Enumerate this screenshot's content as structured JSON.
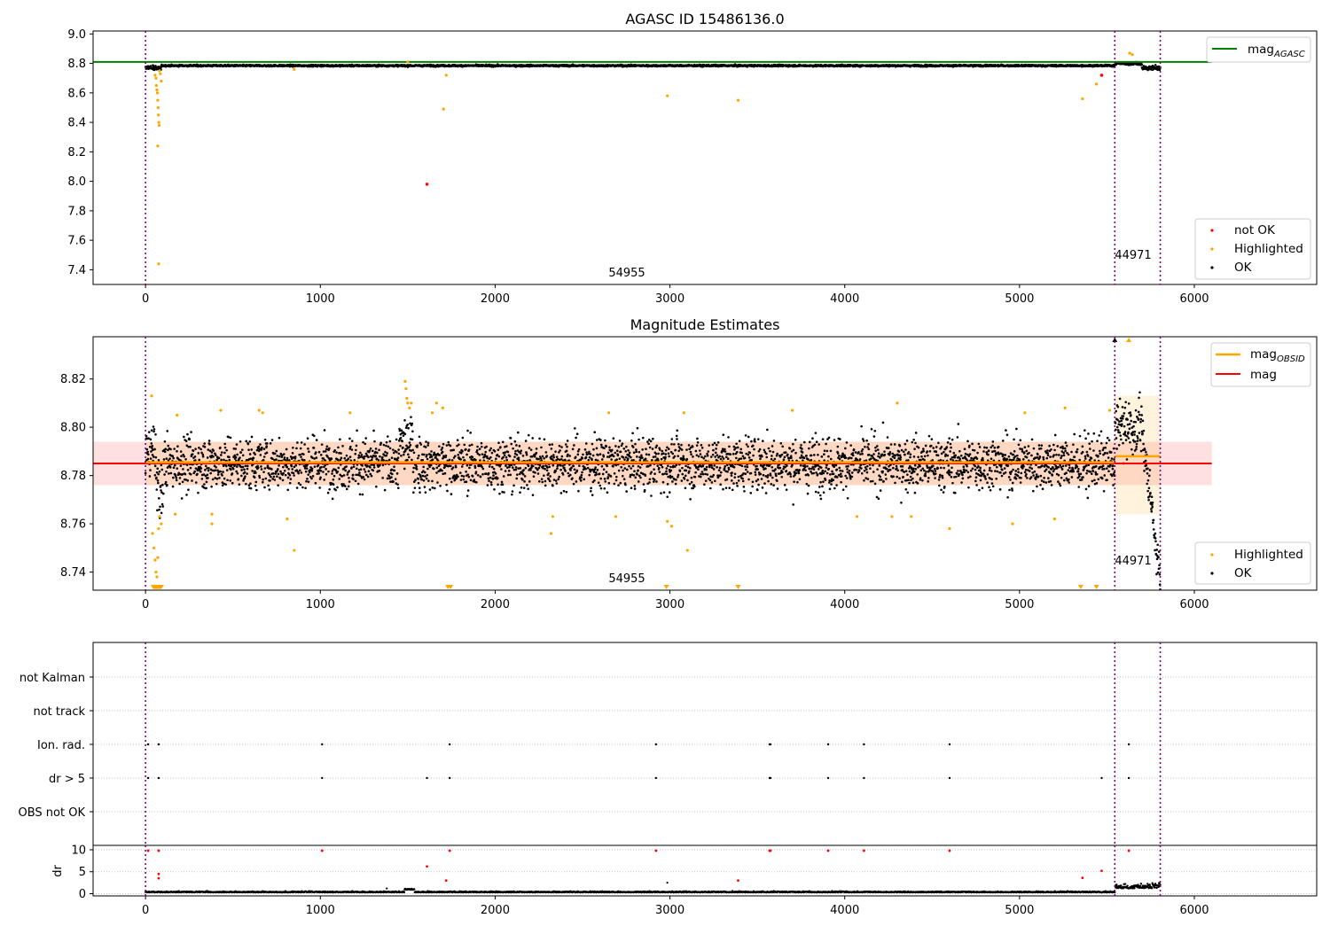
{
  "chart_data": [
    {
      "type": "scatter",
      "title": "AGASC ID 15486136.0",
      "xlim": [
        -300,
        6700
      ],
      "ylim": [
        7.3,
        9.02
      ],
      "x_ticks": [
        0,
        1000,
        2000,
        3000,
        4000,
        5000,
        6000
      ],
      "y_ticks": [
        7.4,
        7.6,
        7.8,
        8.0,
        8.2,
        8.4,
        8.6,
        8.8,
        9.0
      ],
      "x_tick_labels": [
        "0",
        "1000",
        "2000",
        "3000",
        "4000",
        "5000",
        "6000"
      ],
      "y_tick_labels": [
        "7.4",
        "7.6",
        "7.8",
        "8.0",
        "8.2",
        "8.4",
        "8.6",
        "8.8",
        "9.0"
      ],
      "obsid_boundaries": [
        0,
        5545,
        5805
      ],
      "obsid_labels": [
        {
          "text": "54955",
          "x": 2770
        },
        {
          "text": "44971",
          "x": 5675
        }
      ],
      "lines": [
        {
          "name": "mag_AGASC",
          "value": 8.81,
          "x_range": [
            -300,
            6100
          ],
          "color": "#008000"
        }
      ],
      "line_legend_position": "top-right",
      "ok_series": {
        "name": "OK",
        "color": "#000000",
        "x_range": [
          0,
          5805
        ],
        "typical": 8.785,
        "spread": 0.004
      },
      "highlighted": {
        "name": "Highlighted",
        "color": "#ffa500",
        "points": [
          [
            55,
            8.72
          ],
          [
            60,
            8.7
          ],
          [
            62,
            8.65
          ],
          [
            65,
            8.62
          ],
          [
            68,
            8.6
          ],
          [
            70,
            8.55
          ],
          [
            72,
            8.5
          ],
          [
            74,
            8.45
          ],
          [
            76,
            8.4
          ],
          [
            78,
            8.38
          ],
          [
            70,
            8.24
          ],
          [
            75,
            7.44
          ],
          [
            80,
            8.75
          ],
          [
            85,
            8.73
          ],
          [
            90,
            8.68
          ],
          [
            850,
            8.76
          ],
          [
            1500,
            8.81
          ],
          [
            1720,
            8.72
          ],
          [
            1705,
            8.49
          ],
          [
            2985,
            8.58
          ],
          [
            3390,
            8.55
          ],
          [
            5360,
            8.56
          ],
          [
            5440,
            8.66
          ],
          [
            5630,
            8.87
          ],
          [
            5645,
            8.86
          ]
        ]
      },
      "not_ok": {
        "name": "not OK",
        "color": "#ff0000",
        "points": [
          [
            1610,
            7.98
          ],
          [
            5470,
            8.72
          ]
        ]
      },
      "point_legend": [
        "not OK",
        "Highlighted",
        "OK"
      ],
      "point_legend_position": "lower-right"
    },
    {
      "type": "scatter",
      "title": "Magnitude Estimates",
      "xlim": [
        -300,
        6700
      ],
      "ylim": [
        8.7325,
        8.8375
      ],
      "x_ticks": [
        0,
        1000,
        2000,
        3000,
        4000,
        5000,
        6000
      ],
      "y_ticks": [
        8.74,
        8.76,
        8.78,
        8.8,
        8.82
      ],
      "x_tick_labels": [
        "0",
        "1000",
        "2000",
        "3000",
        "4000",
        "5000",
        "6000"
      ],
      "y_tick_labels": [
        "8.74",
        "8.76",
        "8.78",
        "8.80",
        "8.82"
      ],
      "obsid_boundaries": [
        0,
        5545,
        5805
      ],
      "obsid_labels": [
        {
          "text": "54955",
          "x": 2770
        },
        {
          "text": "44971",
          "x": 5675
        }
      ],
      "mag": {
        "name": "mag",
        "value": 8.785,
        "band": [
          8.776,
          8.794
        ],
        "x_range": [
          -300,
          6100
        ],
        "color": "#ff0000"
      },
      "mag_obsid": [
        {
          "name": "mag_OBSID",
          "x_range": [
            0,
            5545
          ],
          "value": 8.7855,
          "band": [
            8.776,
            8.794
          ],
          "color": "#ffa500"
        },
        {
          "name": "mag_OBSID",
          "x_range": [
            5545,
            5805
          ],
          "value": 8.788,
          "band": [
            8.764,
            8.813
          ],
          "color": "#ffa500"
        }
      ],
      "line_legend": [
        "mag_OBSID",
        "mag"
      ],
      "line_legend_position": "top-right",
      "ok_series": {
        "name": "OK",
        "color": "#000000",
        "x_range": [
          0,
          5805
        ],
        "typical": 8.785,
        "spread": 0.0095
      },
      "highlighted": {
        "name": "Highlighted",
        "color": "#ffa500",
        "points": [
          [
            35,
            8.813
          ],
          [
            40,
            8.756
          ],
          [
            48,
            8.75
          ],
          [
            55,
            8.745
          ],
          [
            60,
            8.74
          ],
          [
            65,
            8.738
          ],
          [
            70,
            8.746
          ],
          [
            75,
            8.758
          ],
          [
            80,
            8.763
          ],
          [
            90,
            8.76
          ],
          [
            170,
            8.764
          ],
          [
            180,
            8.805
          ],
          [
            380,
            8.76
          ],
          [
            380,
            8.764
          ],
          [
            430,
            8.807
          ],
          [
            650,
            8.807
          ],
          [
            670,
            8.806
          ],
          [
            810,
            8.762
          ],
          [
            850,
            8.749
          ],
          [
            1170,
            8.806
          ],
          [
            1485,
            8.819
          ],
          [
            1490,
            8.816
          ],
          [
            1495,
            8.812
          ],
          [
            1500,
            8.81
          ],
          [
            1510,
            8.808
          ],
          [
            1520,
            8.81
          ],
          [
            1640,
            8.806
          ],
          [
            1665,
            8.81
          ],
          [
            1700,
            8.808
          ],
          [
            2320,
            8.756
          ],
          [
            2330,
            8.763
          ],
          [
            2650,
            8.806
          ],
          [
            2690,
            8.763
          ],
          [
            2985,
            8.761
          ],
          [
            3010,
            8.759
          ],
          [
            3080,
            8.806
          ],
          [
            3100,
            8.749
          ],
          [
            3700,
            8.807
          ],
          [
            4070,
            8.763
          ],
          [
            4270,
            8.763
          ],
          [
            4300,
            8.81
          ],
          [
            4380,
            8.763
          ],
          [
            4600,
            8.758
          ],
          [
            4960,
            8.76
          ],
          [
            5030,
            8.806
          ],
          [
            5200,
            8.762
          ],
          [
            5260,
            8.808
          ],
          [
            5515,
            8.807
          ]
        ]
      },
      "clipped_low": [
        45,
        50,
        55,
        60,
        65,
        70,
        75,
        80,
        85,
        90,
        1730,
        1745,
        2980,
        3390,
        5350,
        5440
      ],
      "clipped_high": [
        {
          "x": 5545,
          "color": "#000000"
        },
        {
          "x": 5625,
          "color": "#ffa500"
        }
      ],
      "point_legend": [
        "Highlighted",
        "OK"
      ],
      "point_legend_position": "lower-right"
    },
    {
      "type": "scatter",
      "title": "",
      "xlim": [
        -300,
        6700
      ],
      "flag_categories": [
        "not Kalman",
        "not track",
        "Ion. rad.",
        "dr > 5",
        "OBS not OK"
      ],
      "flag_points": {
        "Ion. rad.": [
          15,
          75,
          1010,
          1740,
          2920,
          3570,
          3575,
          3905,
          4110,
          4600,
          5625
        ],
        "dr > 5": [
          15,
          75,
          1010,
          1610,
          1740,
          2920,
          3570,
          3575,
          3905,
          4110,
          4600,
          5470,
          5625
        ]
      },
      "dr": {
        "ylabel": "dr",
        "ylim": [
          -0.5,
          11
        ],
        "y_ticks": [
          0,
          5,
          10
        ],
        "y_tick_labels": [
          "0",
          "5",
          "10"
        ],
        "typical": 0.3,
        "red_points": [
          [
            15,
            9.8
          ],
          [
            75,
            9.8
          ],
          [
            1010,
            9.8
          ],
          [
            1740,
            9.8
          ],
          [
            2920,
            9.8
          ],
          [
            3570,
            9.8
          ],
          [
            3575,
            9.8
          ],
          [
            3905,
            9.8
          ],
          [
            4110,
            9.8
          ],
          [
            4600,
            9.8
          ],
          [
            5625,
            9.8
          ],
          [
            75,
            4.5
          ],
          [
            75,
            3.5
          ],
          [
            1610,
            6.2
          ],
          [
            1720,
            3.0
          ],
          [
            3390,
            3.0
          ],
          [
            5360,
            3.6
          ],
          [
            5470,
            5.2
          ]
        ],
        "black_outliers": [
          [
            2985,
            2.5
          ],
          [
            1380,
            1.2
          ]
        ]
      },
      "x_ticks": [
        0,
        1000,
        2000,
        3000,
        4000,
        5000,
        6000
      ],
      "x_tick_labels": [
        "0",
        "1000",
        "2000",
        "3000",
        "4000",
        "5000",
        "6000"
      ],
      "obsid_boundaries": [
        0,
        5545,
        5805
      ]
    }
  ]
}
